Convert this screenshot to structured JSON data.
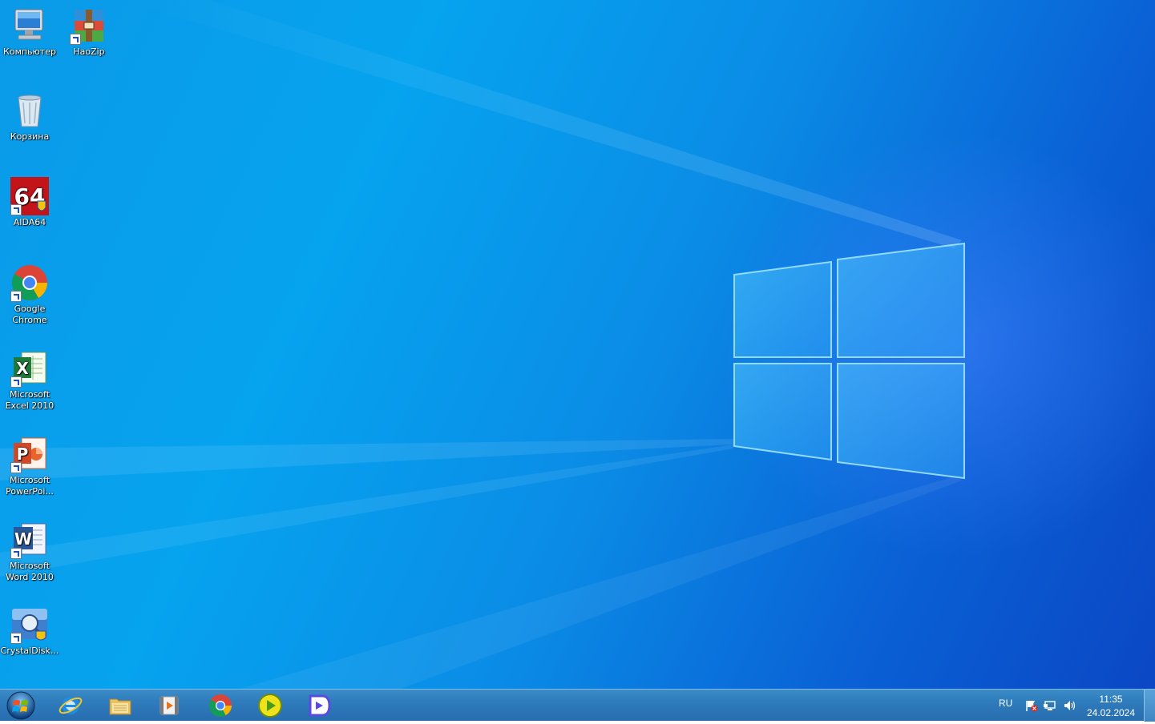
{
  "desktop": {
    "icons": [
      {
        "label": "Компьютер",
        "icon": "computer-icon"
      },
      {
        "label": "HaoZip",
        "icon": "haozip-icon"
      },
      {
        "label": "Корзина",
        "icon": "recycle-bin-icon"
      },
      {
        "label": "AIDA64",
        "icon": "aida64-icon"
      },
      {
        "label": "Google Chrome",
        "icon": "chrome-icon"
      },
      {
        "label": "Microsoft Excel 2010",
        "icon": "excel-icon"
      },
      {
        "label": "Microsoft PowerPoi...",
        "icon": "powerpoint-icon"
      },
      {
        "label": "Microsoft Word 2010",
        "icon": "word-icon"
      },
      {
        "label": "CrystalDisk...",
        "icon": "crystaldisk-icon"
      }
    ]
  },
  "taskbar": {
    "start": "start-orb-icon",
    "pinned": [
      "internet-explorer-icon",
      "explorer-folder-icon",
      "media-player-icon",
      "chrome-icon",
      "player-play-icon",
      "daum-potplayer-icon"
    ],
    "tray": {
      "language": "RU",
      "icons": [
        "action-center-flag-icon",
        "network-icon",
        "volume-icon"
      ],
      "time": "11:35",
      "date": "24.02.2024"
    }
  },
  "colors": {
    "wallpaper_blue": "#0a9ae8",
    "taskbar_blue": "#2f7bbb"
  }
}
